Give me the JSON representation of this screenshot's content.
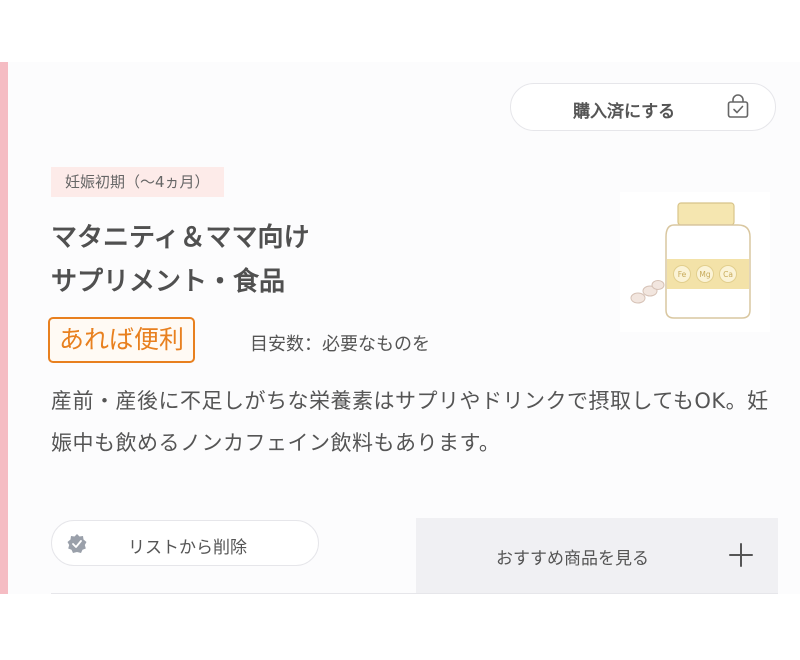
{
  "actions": {
    "purchased_label": "購入済にする",
    "remove_label": "リストから削除",
    "recommend_label": "おすすめ商品を見る"
  },
  "item": {
    "period_tag": "妊娠初期（〜4ヵ月）",
    "title_line1": "マタニティ＆ママ向け",
    "title_line2": "サプリメント・食品",
    "need_badge": "あれば便利",
    "count_label": "目安数：必要なものを",
    "description": "産前・産後に不足しがちな栄養素はサプリやドリンクで摂取してもOK。妊娠中も飲めるノンカフェイン飲料もあります。",
    "image_labels": [
      "Fe",
      "Mg",
      "Ca"
    ]
  },
  "icons": {
    "purchased": "shopping-bag-check-icon",
    "remove": "badge-check-icon",
    "recommend": "plus-icon"
  },
  "colors": {
    "accent_bar": "#f5bcc3",
    "need_badge": "#e8801f",
    "period_tag_bg": "#fdebe9",
    "recommend_bg": "#f0f0f3"
  }
}
